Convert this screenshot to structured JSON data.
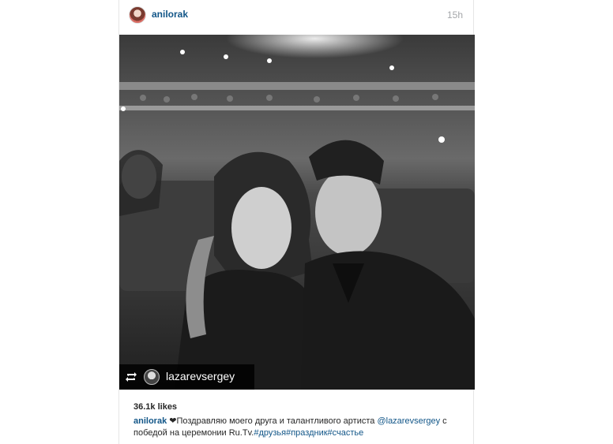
{
  "post": {
    "username": "anilorak",
    "time_ago": "15h",
    "repost_username": "lazarevsergey",
    "likes": "36.1k likes",
    "caption": {
      "author": "anilorak",
      "heart": "❤",
      "text_1": "Поздравляю моего друга и талантливого артиста ",
      "mention": "@lazarevsergey",
      "text_2": " с победой на церемонии Ru.Tv.",
      "hashtags": "#друзья#праздник#счастье"
    }
  },
  "icons": {
    "avatar": "avatar-icon",
    "repost": "repost-icon"
  },
  "colors": {
    "link": "#125688",
    "meta": "#a5a7aa",
    "text": "#262626"
  }
}
